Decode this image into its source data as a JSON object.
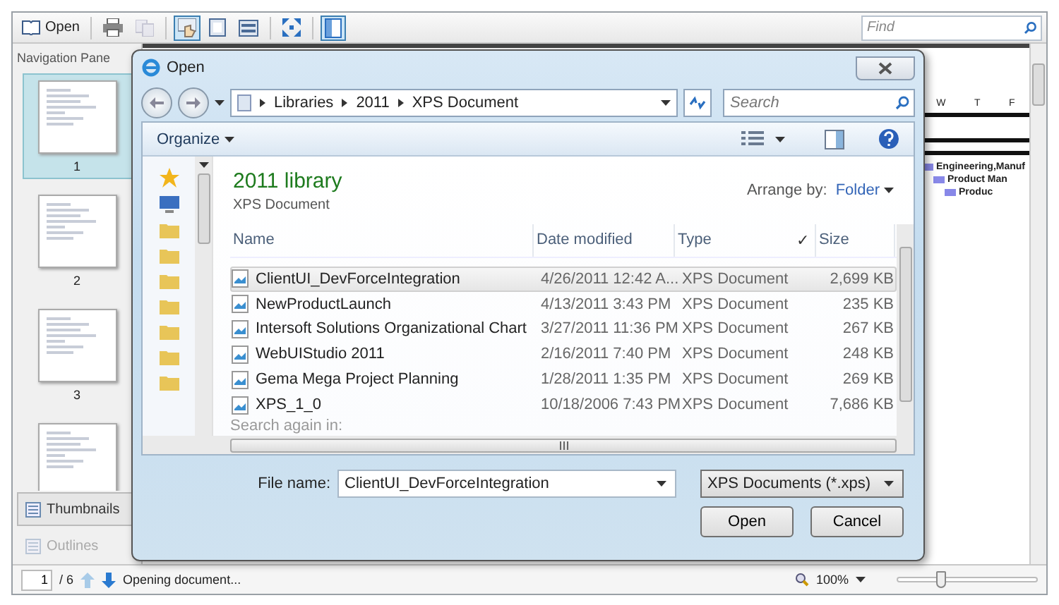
{
  "toolbar": {
    "open_label": "Open",
    "tools": [
      {
        "kind": "print",
        "selected": false,
        "disabled": false
      },
      {
        "kind": "copy",
        "selected": false,
        "disabled": true
      },
      {
        "kind": "select",
        "selected": true,
        "disabled": false
      },
      {
        "kind": "single-page",
        "selected": false,
        "disabled": false
      },
      {
        "kind": "two-page",
        "selected": false,
        "disabled": false
      },
      {
        "kind": "fit",
        "selected": false,
        "disabled": false
      },
      {
        "kind": "pane",
        "selected": true,
        "disabled": false
      }
    ],
    "find": {
      "placeholder": "Find"
    }
  },
  "nav_pane": {
    "title": "Navigation Pane",
    "thumbnails": [
      {
        "label": "1",
        "selected": true
      },
      {
        "label": "2",
        "selected": false
      },
      {
        "label": "3",
        "selected": false
      },
      {
        "selected": false
      }
    ],
    "tabs": [
      {
        "label": "Thumbnails",
        "selected": true,
        "disabled": false
      },
      {
        "label": "Outlines",
        "selected": false,
        "disabled": true
      }
    ]
  },
  "gantt": {
    "days": [
      "W",
      "T",
      "F"
    ],
    "tasks": [
      {
        "label": "Engineering,Manuf"
      },
      {
        "label": "Product Man"
      },
      {
        "label": "Produc"
      }
    ]
  },
  "status_bar": {
    "page": "1",
    "page_count": "/ 6",
    "message": "Opening document...",
    "zoom": "100%",
    "zoom_slider": {
      "level": 0.32
    }
  },
  "dialog": {
    "title": "Open",
    "breadcrumb": [
      "Libraries",
      "2011",
      "XPS Document"
    ],
    "search": {
      "placeholder": "Search"
    },
    "organize": "Organize",
    "library_title": "2011 library",
    "library_subtitle": "XPS Document",
    "arrange_label": "Arrange by:",
    "arrange_value": "Folder",
    "columns": [
      {
        "label": "Name"
      },
      {
        "label": "Date modified"
      },
      {
        "label": "Type",
        "mark": "✓"
      },
      {
        "label": "Size"
      }
    ],
    "rows": [
      {
        "name": "ClientUI_DevForceIntegration",
        "date": "4/26/2011 12:42 A...",
        "type": "XPS Document",
        "size": "2,699 KB",
        "selected": true
      },
      {
        "name": "NewProductLaunch",
        "date": "4/13/2011 3:43 PM",
        "type": "XPS Document",
        "size": "235 KB",
        "selected": false
      },
      {
        "name": "Intersoft Solutions Organizational Chart",
        "date": "3/27/2011 11:36 PM",
        "type": "XPS Document",
        "size": "267 KB",
        "selected": false
      },
      {
        "name": "WebUIStudio 2011",
        "date": "2/16/2011 7:40 PM",
        "type": "XPS Document",
        "size": "248 KB",
        "selected": false
      },
      {
        "name": "Gema Mega Project Planning",
        "date": "1/28/2011 1:35 PM",
        "type": "XPS Document",
        "size": "269 KB",
        "selected": false
      },
      {
        "name": "XPS_1_0",
        "date": "10/18/2006 7:43 PM",
        "type": "XPS Document",
        "size": "7,686 KB",
        "selected": false
      }
    ],
    "search_again": "Search again in:",
    "file_name_label": "File name:",
    "file_name": "ClientUI_DevForceIntegration",
    "filter": "XPS Documents (*.xps)",
    "buttons": [
      "Open",
      "Cancel"
    ]
  }
}
